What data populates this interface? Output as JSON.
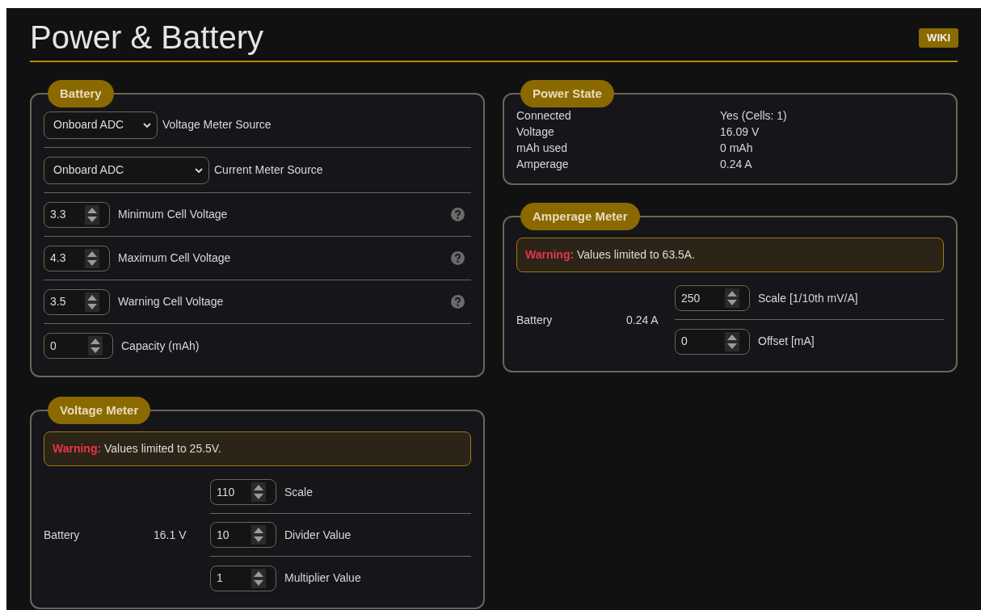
{
  "page": {
    "title": "Power & Battery",
    "wiki_button": "WIKI"
  },
  "battery": {
    "legend": "Battery",
    "rows": [
      {
        "kind": "select",
        "value": "Onboard ADC",
        "label": "Voltage Meter Source",
        "help": false
      },
      {
        "kind": "select",
        "value": "Onboard ADC",
        "label": "Current Meter Source",
        "help": false
      },
      {
        "kind": "number",
        "value": "3.3",
        "label": "Minimum Cell Voltage",
        "help": true
      },
      {
        "kind": "number",
        "value": "4.3",
        "label": "Maximum Cell Voltage",
        "help": true
      },
      {
        "kind": "number",
        "value": "3.5",
        "label": "Warning Cell Voltage",
        "help": true
      },
      {
        "kind": "number",
        "value": "0",
        "label": "Capacity (mAh)",
        "help": false
      }
    ]
  },
  "voltage_meter": {
    "legend": "Voltage Meter",
    "warning": "**Warning:** Values limited to 25.5V.",
    "meters": [
      {
        "name": "Battery",
        "reading": "16.1 V",
        "fields": [
          {
            "value": "110",
            "label": "Scale"
          },
          {
            "value": "10",
            "label": "Divider Value"
          },
          {
            "value": "1",
            "label": "Multiplier Value"
          }
        ]
      }
    ]
  },
  "power_state": {
    "legend": "Power State",
    "rows": [
      {
        "label": "Connected",
        "value": "Yes (Cells: 1)"
      },
      {
        "label": "Voltage",
        "value": "16.09 V"
      },
      {
        "label": "mAh used",
        "value": "0 mAh"
      },
      {
        "label": "Amperage",
        "value": "0.24 A"
      }
    ]
  },
  "amperage_meter": {
    "legend": "Amperage Meter",
    "warning": "**Warning:** Values limited to 63.5A.",
    "meters": [
      {
        "name": "Battery",
        "reading": "0.24 A",
        "fields": [
          {
            "value": "250",
            "label": "Scale [1/10th mV/A]"
          },
          {
            "value": "0",
            "label": "Offset [mA]"
          }
        ]
      }
    ]
  }
}
